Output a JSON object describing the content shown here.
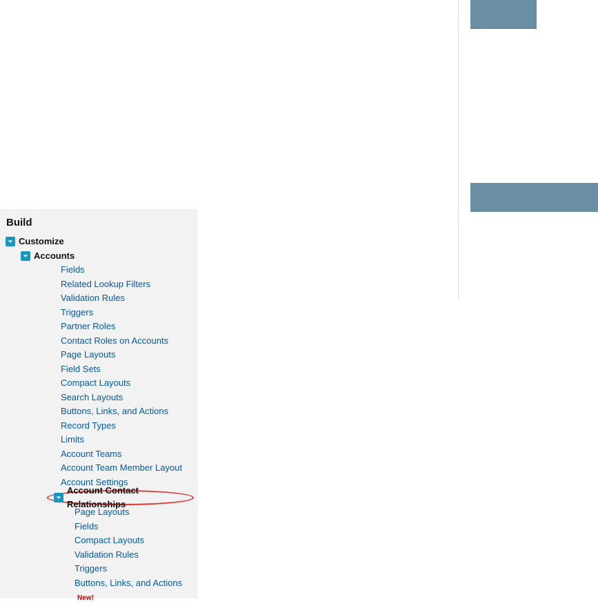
{
  "section_title": "Build",
  "new_badge": "New!",
  "tree": {
    "customize": "Customize",
    "accounts": "Accounts",
    "accounts_children": [
      "Fields",
      "Related Lookup Filters",
      "Validation Rules",
      "Triggers",
      "Partner Roles",
      "Contact Roles on Accounts",
      "Page Layouts",
      "Field Sets",
      "Compact Layouts",
      "Search Layouts",
      "Buttons, Links, and Actions",
      "Record Types",
      "Limits",
      "Account Teams",
      "Account Team Member Layout",
      "Account Settings"
    ],
    "acr": "Account Contact Relationships",
    "acr_children": [
      "Page Layouts",
      "Fields",
      "Compact Layouts",
      "Validation Rules",
      "Triggers",
      "Buttons, Links, and Actions"
    ]
  }
}
